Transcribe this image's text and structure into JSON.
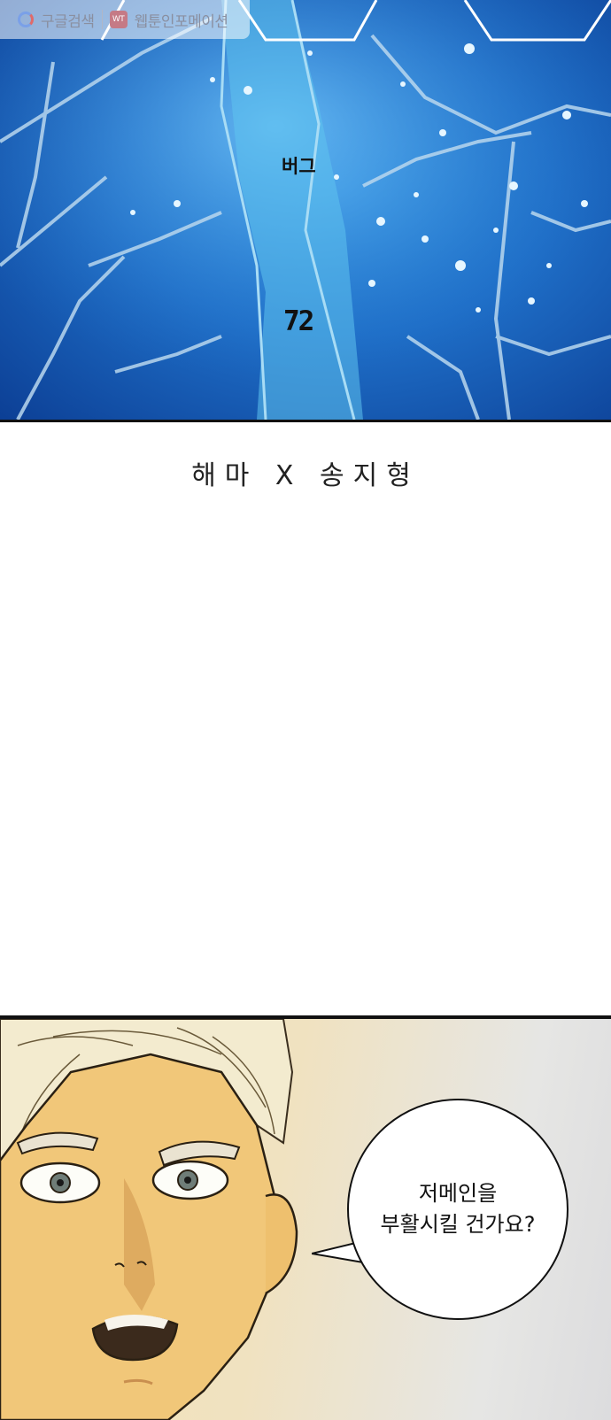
{
  "watermark": {
    "google_search": "구글검색",
    "site_name": "웹툰인포메이션",
    "badge": "WT"
  },
  "episode": {
    "title": "버그",
    "number": "72"
  },
  "credits": "해마 X 송지형",
  "speech_bubble": {
    "line1": "저메인을",
    "line2": "부활시킬 건가요?"
  },
  "colors": {
    "blue_panel": "#1f6fc8",
    "ink": "#111111"
  }
}
